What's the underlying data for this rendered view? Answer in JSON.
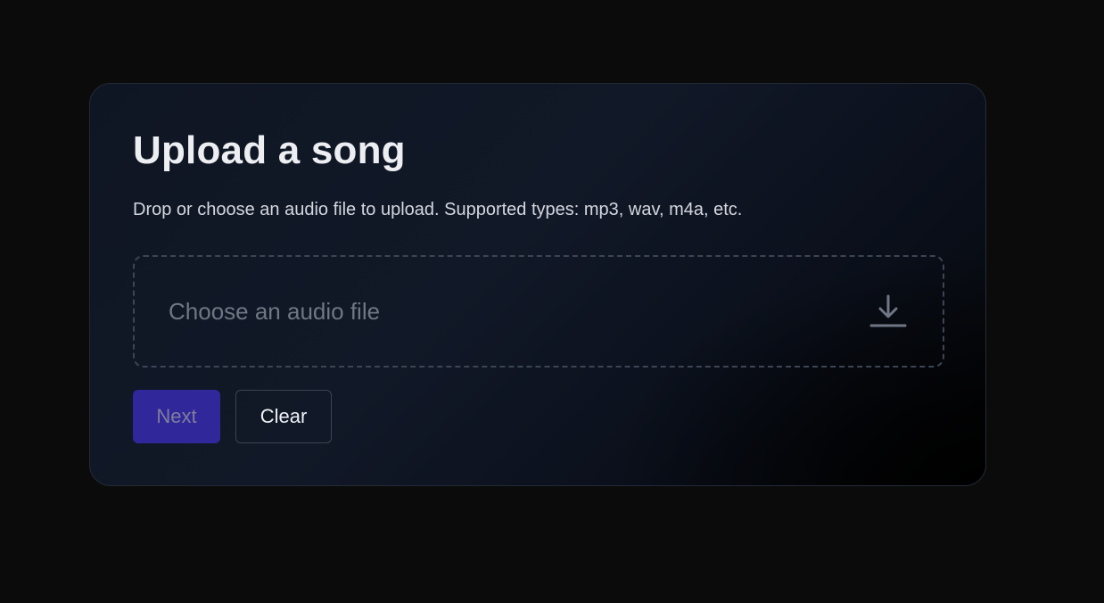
{
  "upload": {
    "title": "Upload a song",
    "subtitle": "Drop or choose an audio file to upload. Supported types: mp3, wav, m4a, etc.",
    "dropzone_label": "Choose an audio file",
    "dropzone_icon": "download-icon",
    "next_label": "Next",
    "clear_label": "Clear"
  },
  "colors": {
    "page_background": "#0b0b0b",
    "accent": "#30279a",
    "muted_text": "#6f7684"
  }
}
